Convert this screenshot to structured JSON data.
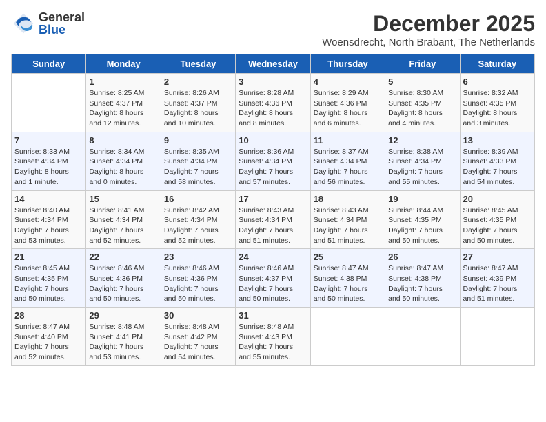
{
  "header": {
    "logo_general": "General",
    "logo_blue": "Blue",
    "month_title": "December 2025",
    "subtitle": "Woensdrecht, North Brabant, The Netherlands"
  },
  "weekdays": [
    "Sunday",
    "Monday",
    "Tuesday",
    "Wednesday",
    "Thursday",
    "Friday",
    "Saturday"
  ],
  "weeks": [
    [
      {
        "day": "",
        "info": ""
      },
      {
        "day": "1",
        "info": "Sunrise: 8:25 AM\nSunset: 4:37 PM\nDaylight: 8 hours\nand 12 minutes."
      },
      {
        "day": "2",
        "info": "Sunrise: 8:26 AM\nSunset: 4:37 PM\nDaylight: 8 hours\nand 10 minutes."
      },
      {
        "day": "3",
        "info": "Sunrise: 8:28 AM\nSunset: 4:36 PM\nDaylight: 8 hours\nand 8 minutes."
      },
      {
        "day": "4",
        "info": "Sunrise: 8:29 AM\nSunset: 4:36 PM\nDaylight: 8 hours\nand 6 minutes."
      },
      {
        "day": "5",
        "info": "Sunrise: 8:30 AM\nSunset: 4:35 PM\nDaylight: 8 hours\nand 4 minutes."
      },
      {
        "day": "6",
        "info": "Sunrise: 8:32 AM\nSunset: 4:35 PM\nDaylight: 8 hours\nand 3 minutes."
      }
    ],
    [
      {
        "day": "7",
        "info": "Sunrise: 8:33 AM\nSunset: 4:34 PM\nDaylight: 8 hours\nand 1 minute."
      },
      {
        "day": "8",
        "info": "Sunrise: 8:34 AM\nSunset: 4:34 PM\nDaylight: 8 hours\nand 0 minutes."
      },
      {
        "day": "9",
        "info": "Sunrise: 8:35 AM\nSunset: 4:34 PM\nDaylight: 7 hours\nand 58 minutes."
      },
      {
        "day": "10",
        "info": "Sunrise: 8:36 AM\nSunset: 4:34 PM\nDaylight: 7 hours\nand 57 minutes."
      },
      {
        "day": "11",
        "info": "Sunrise: 8:37 AM\nSunset: 4:34 PM\nDaylight: 7 hours\nand 56 minutes."
      },
      {
        "day": "12",
        "info": "Sunrise: 8:38 AM\nSunset: 4:34 PM\nDaylight: 7 hours\nand 55 minutes."
      },
      {
        "day": "13",
        "info": "Sunrise: 8:39 AM\nSunset: 4:33 PM\nDaylight: 7 hours\nand 54 minutes."
      }
    ],
    [
      {
        "day": "14",
        "info": "Sunrise: 8:40 AM\nSunset: 4:34 PM\nDaylight: 7 hours\nand 53 minutes."
      },
      {
        "day": "15",
        "info": "Sunrise: 8:41 AM\nSunset: 4:34 PM\nDaylight: 7 hours\nand 52 minutes."
      },
      {
        "day": "16",
        "info": "Sunrise: 8:42 AM\nSunset: 4:34 PM\nDaylight: 7 hours\nand 52 minutes."
      },
      {
        "day": "17",
        "info": "Sunrise: 8:43 AM\nSunset: 4:34 PM\nDaylight: 7 hours\nand 51 minutes."
      },
      {
        "day": "18",
        "info": "Sunrise: 8:43 AM\nSunset: 4:34 PM\nDaylight: 7 hours\nand 51 minutes."
      },
      {
        "day": "19",
        "info": "Sunrise: 8:44 AM\nSunset: 4:35 PM\nDaylight: 7 hours\nand 50 minutes."
      },
      {
        "day": "20",
        "info": "Sunrise: 8:45 AM\nSunset: 4:35 PM\nDaylight: 7 hours\nand 50 minutes."
      }
    ],
    [
      {
        "day": "21",
        "info": "Sunrise: 8:45 AM\nSunset: 4:35 PM\nDaylight: 7 hours\nand 50 minutes."
      },
      {
        "day": "22",
        "info": "Sunrise: 8:46 AM\nSunset: 4:36 PM\nDaylight: 7 hours\nand 50 minutes."
      },
      {
        "day": "23",
        "info": "Sunrise: 8:46 AM\nSunset: 4:36 PM\nDaylight: 7 hours\nand 50 minutes."
      },
      {
        "day": "24",
        "info": "Sunrise: 8:46 AM\nSunset: 4:37 PM\nDaylight: 7 hours\nand 50 minutes."
      },
      {
        "day": "25",
        "info": "Sunrise: 8:47 AM\nSunset: 4:38 PM\nDaylight: 7 hours\nand 50 minutes."
      },
      {
        "day": "26",
        "info": "Sunrise: 8:47 AM\nSunset: 4:38 PM\nDaylight: 7 hours\nand 50 minutes."
      },
      {
        "day": "27",
        "info": "Sunrise: 8:47 AM\nSunset: 4:39 PM\nDaylight: 7 hours\nand 51 minutes."
      }
    ],
    [
      {
        "day": "28",
        "info": "Sunrise: 8:47 AM\nSunset: 4:40 PM\nDaylight: 7 hours\nand 52 minutes."
      },
      {
        "day": "29",
        "info": "Sunrise: 8:48 AM\nSunset: 4:41 PM\nDaylight: 7 hours\nand 53 minutes."
      },
      {
        "day": "30",
        "info": "Sunrise: 8:48 AM\nSunset: 4:42 PM\nDaylight: 7 hours\nand 54 minutes."
      },
      {
        "day": "31",
        "info": "Sunrise: 8:48 AM\nSunset: 4:43 PM\nDaylight: 7 hours\nand 55 minutes."
      },
      {
        "day": "",
        "info": ""
      },
      {
        "day": "",
        "info": ""
      },
      {
        "day": "",
        "info": ""
      }
    ]
  ]
}
